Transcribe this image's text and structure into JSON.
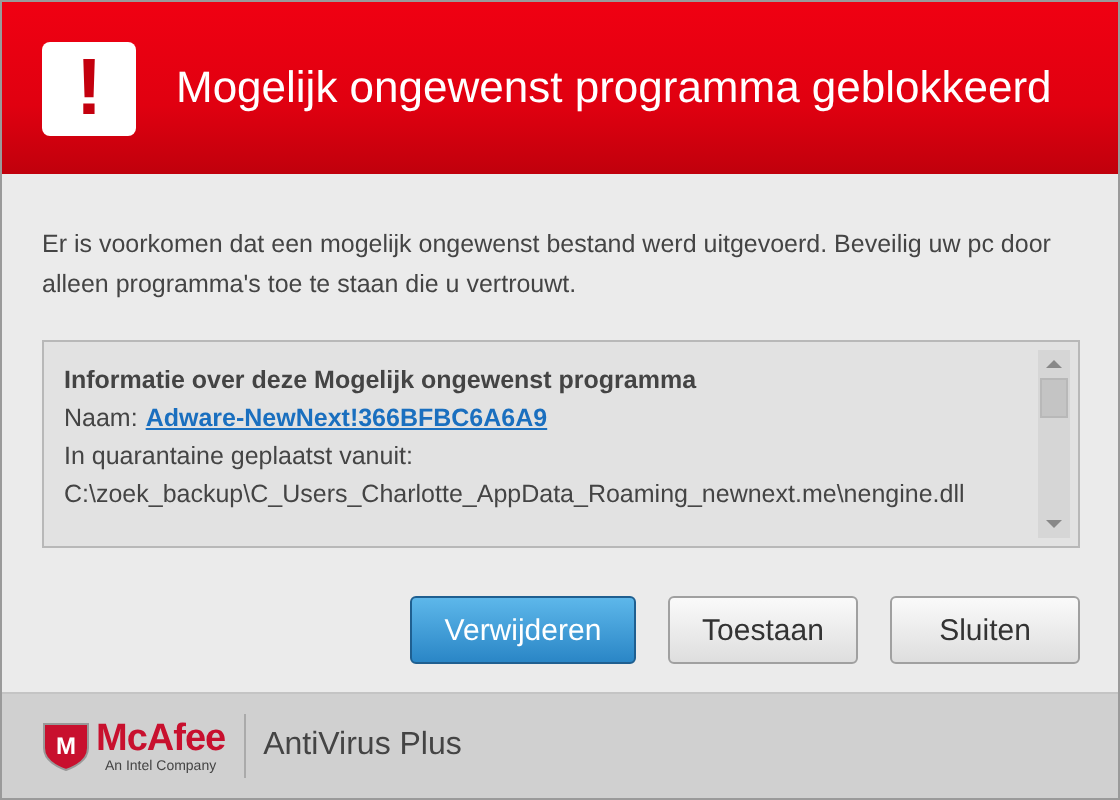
{
  "header": {
    "icon_glyph": "!",
    "title": "Mogelijk ongewenst programma geblokkeerd"
  },
  "message": "Er is voorkomen dat een mogelijk ongewenst bestand werd uitgevoerd. Beveilig uw pc door alleen programma's toe te staan die u vertrouwt.",
  "info": {
    "heading": "Informatie over deze Mogelijk ongewenst programma",
    "name_label": "Naam:",
    "name_link": "Adware-NewNext!366BFBC6A6A9",
    "origin_label": "In quarantaine geplaatst vanuit:",
    "path": "C:\\zoek_backup\\C_Users_Charlotte_AppData_Roaming_newnext.me\\nengine.dll"
  },
  "buttons": [
    {
      "label": "Verwijderen",
      "kind": "primary"
    },
    {
      "label": "Toestaan",
      "kind": "secondary"
    },
    {
      "label": "Sluiten",
      "kind": "secondary"
    }
  ],
  "footer": {
    "logo_mark": "M",
    "brand": "McAfee",
    "tagline": "An Intel Company",
    "product": "AntiVirus Plus"
  }
}
